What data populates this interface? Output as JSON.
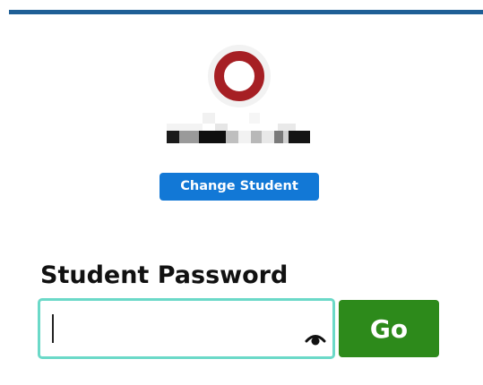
{
  "student": {
    "avatar_icon": "avatar-ring-icon",
    "avatar_color": "#a61f24",
    "name_obscured": true,
    "change_label": "Change Student"
  },
  "password": {
    "label": "Student Password",
    "value": "",
    "placeholder": "",
    "show_icon": "eye-icon"
  },
  "actions": {
    "go_label": "Go"
  },
  "colors": {
    "top_bar": "#1f5f96",
    "change_button": "#1278d6",
    "go_button": "#2d8a1b",
    "input_focus_border": "#6bd9c8"
  }
}
